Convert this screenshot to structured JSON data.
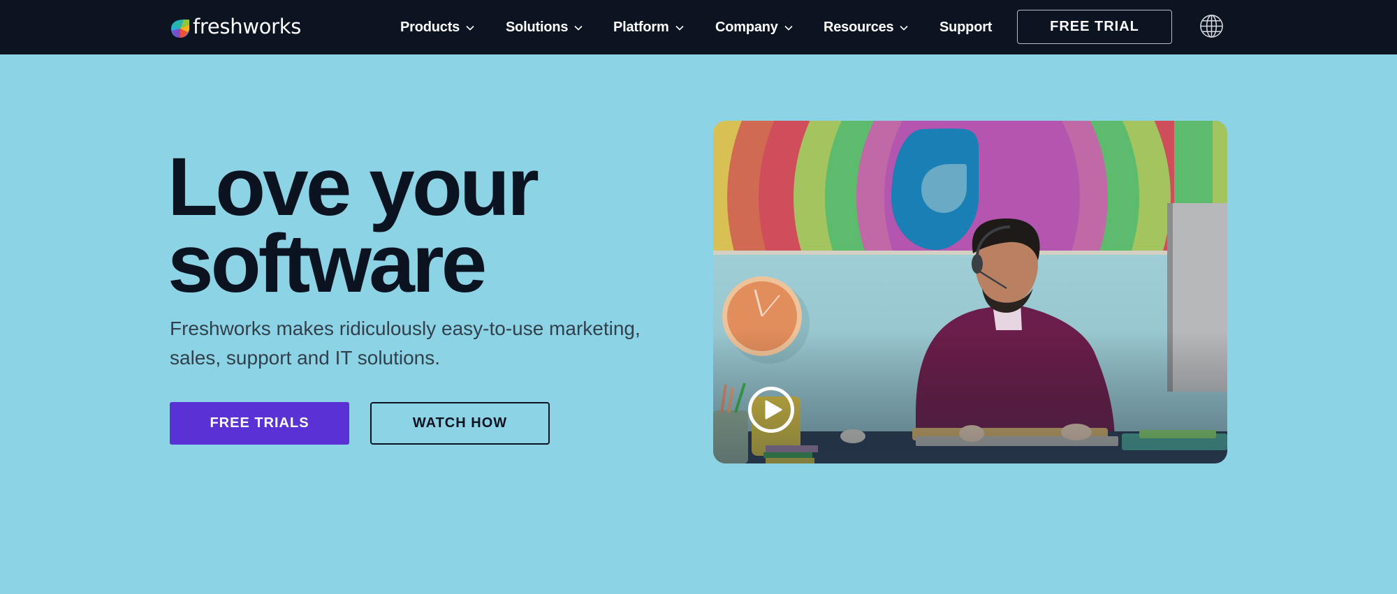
{
  "brand": {
    "name": "freshworks",
    "colors": {
      "nav_bg": "#0c1321",
      "hero_bg": "#8cd3e5",
      "primary_button": "#5a31d4",
      "heading": "#0b1220",
      "subtext": "#32404c"
    }
  },
  "nav": {
    "items": [
      {
        "label": "Products",
        "has_dropdown": true
      },
      {
        "label": "Solutions",
        "has_dropdown": true
      },
      {
        "label": "Platform",
        "has_dropdown": true
      },
      {
        "label": "Company",
        "has_dropdown": true
      },
      {
        "label": "Resources",
        "has_dropdown": true
      },
      {
        "label": "Support",
        "has_dropdown": false
      }
    ],
    "cta_label": "FREE TRIAL",
    "language_icon": "globe-icon"
  },
  "hero": {
    "title_line1": "Love your",
    "title_line2": "software",
    "subtitle": "Freshworks makes ridiculously easy-to-use marketing, sales, support and IT solutions.",
    "primary_cta": "FREE TRIALS",
    "secondary_cta": "WATCH HOW"
  },
  "video": {
    "description": "Support agent with headset typing at a desk in front of a rainbow Freshworks mural",
    "play_icon": "play-icon"
  }
}
